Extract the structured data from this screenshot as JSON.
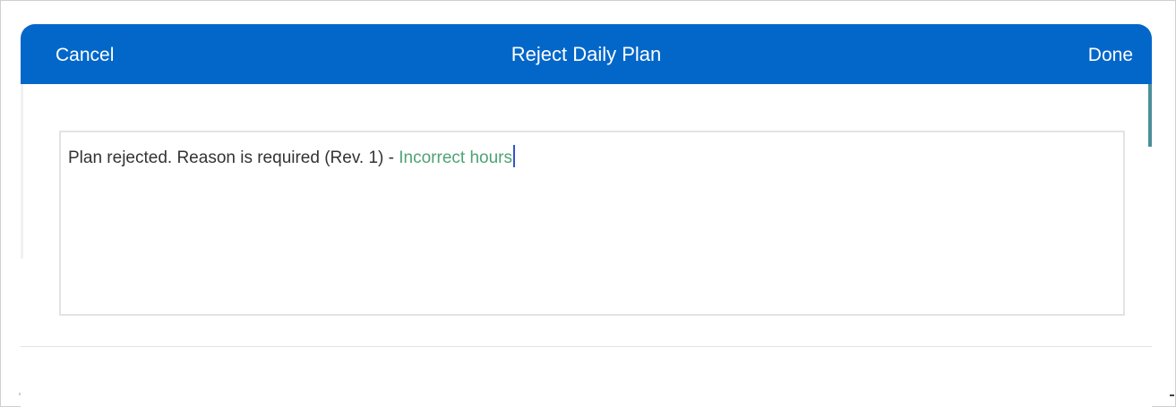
{
  "header": {
    "cancel_label": "Cancel",
    "title": "Reject Daily Plan",
    "done_label": "Done"
  },
  "reason_field": {
    "value_prefix": "Plan rejected. Reason is required (Rev. 1) - ",
    "value_entered": "Incorrect hours"
  },
  "colors": {
    "header_bg": "#0367c9",
    "entered_text": "#4fa274",
    "caret": "#2f56c9"
  }
}
